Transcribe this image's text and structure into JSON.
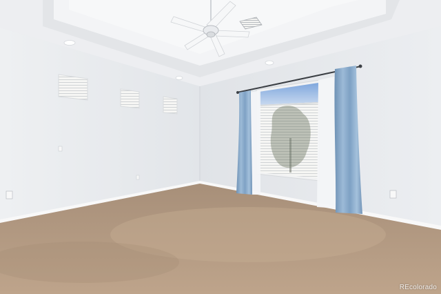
{
  "watermark": {
    "text": "REcolorado"
  },
  "palette": {
    "wall_left": "#ebedf0",
    "wall_right": "#e6e8eb",
    "ceiling": "#f1f2f4",
    "tray": "#e4e6e9",
    "carpet": "#b79e86",
    "carpet_shadow": "#a68c74",
    "baseboard": "#f7f7f7",
    "curtain": "#8fb0cf",
    "curtain_shadow": "#6f92b5",
    "sheer": "#f4f5f7",
    "window_sky": "#9bbce6",
    "blinds": "#f2f2f0",
    "foliage": "#5f6a52"
  },
  "icons": {
    "fan": "ceiling-fan-icon",
    "vent": "air-vent-icon",
    "light": "recessed-light-icon",
    "outlet": "outlet-icon"
  }
}
